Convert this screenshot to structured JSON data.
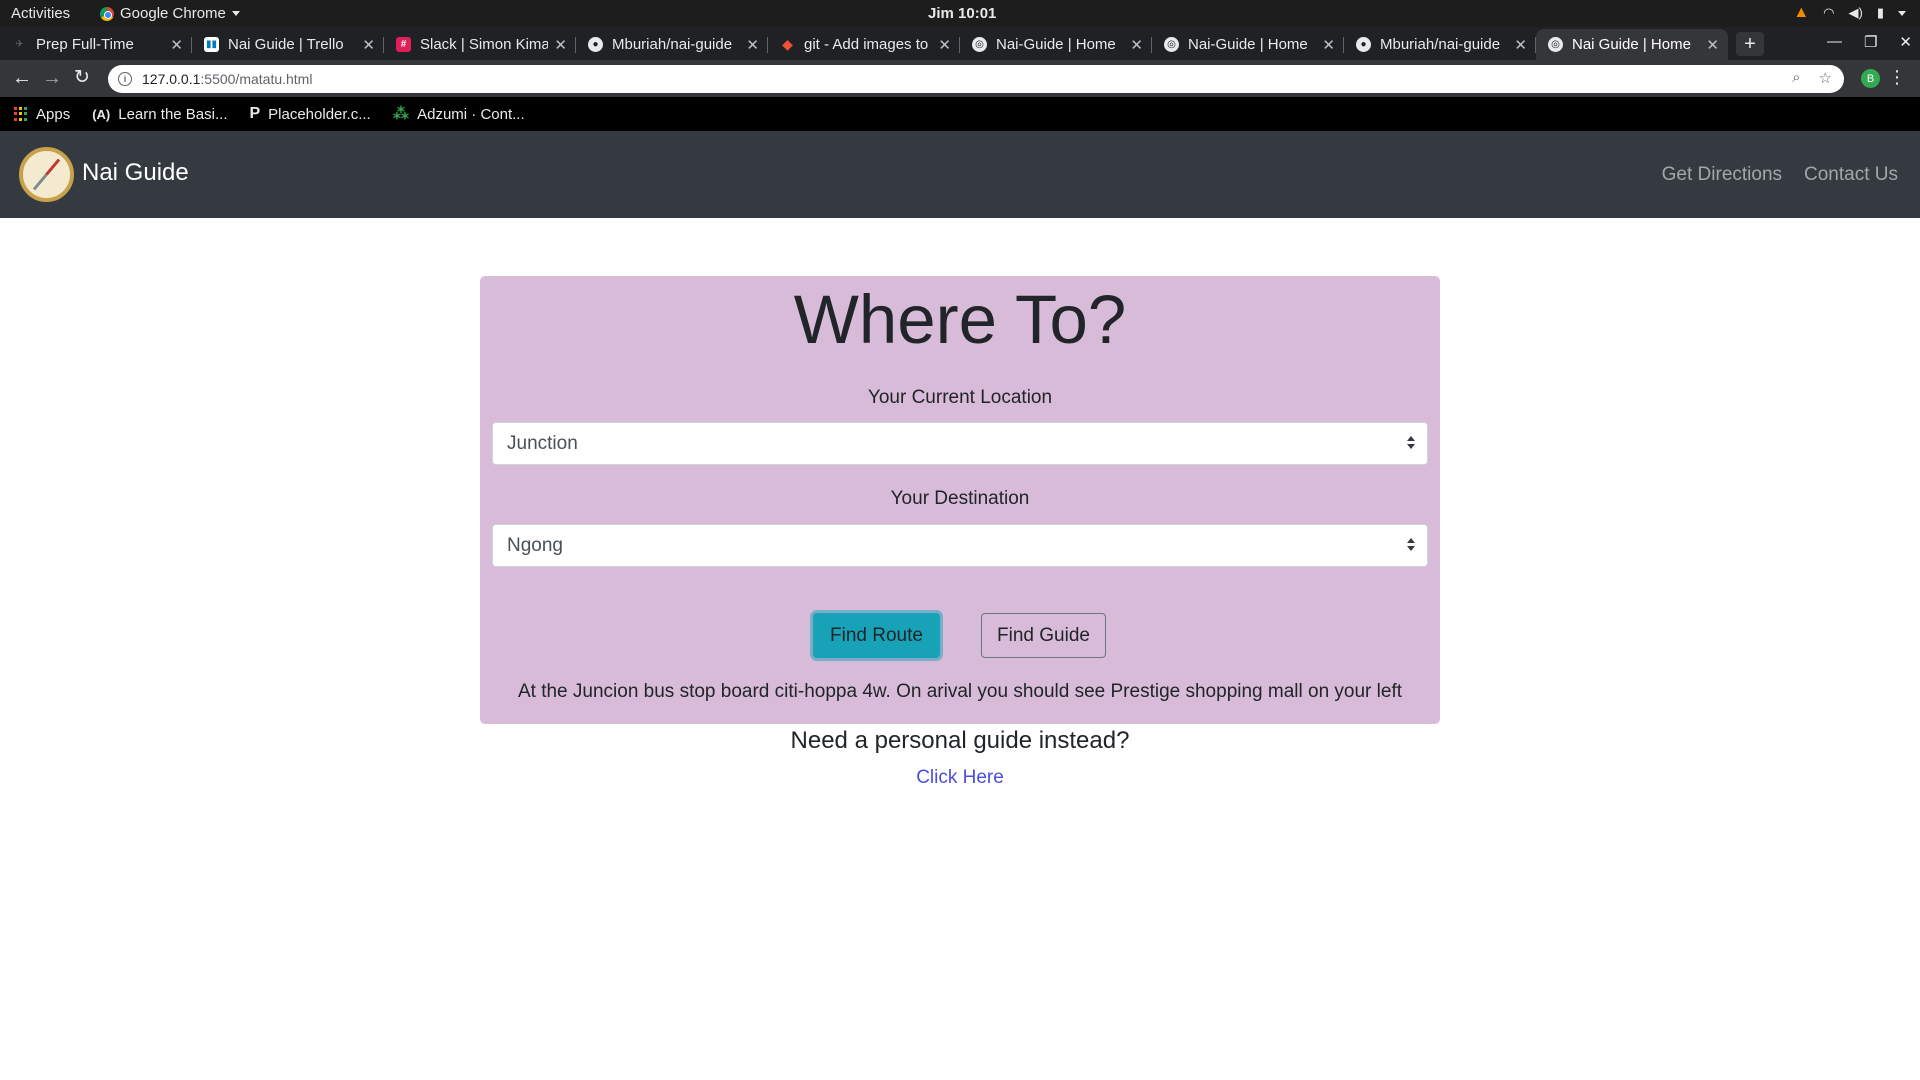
{
  "system_bar": {
    "activities": "Activities",
    "app_name": "Google Chrome",
    "clock": "Jim 10:01"
  },
  "tabs": [
    {
      "title": "Prep Full-Time",
      "icon": "prep-icon",
      "active": false
    },
    {
      "title": "Nai Guide | Trello",
      "icon": "trello-icon",
      "active": false
    },
    {
      "title": "Slack | Simon Kimani",
      "icon": "slack-icon",
      "active": false
    },
    {
      "title": "Mburiah/nai-guide",
      "icon": "github-icon",
      "active": false
    },
    {
      "title": "git - Add images to",
      "icon": "git-icon",
      "active": false
    },
    {
      "title": "Nai-Guide | Home",
      "icon": "globe-icon",
      "active": false
    },
    {
      "title": "Nai-Guide | Home",
      "icon": "globe-icon",
      "active": false
    },
    {
      "title": "Mburiah/nai-guide",
      "icon": "github-icon",
      "active": false
    },
    {
      "title": "Nai Guide | Home",
      "icon": "globe-icon",
      "active": true
    }
  ],
  "address_bar": {
    "host": "127.0.0.1",
    "path": ":5500/matatu.html"
  },
  "profile_initial": "B",
  "bookmarks": [
    {
      "label": "Apps",
      "icon": "apps-grid-icon"
    },
    {
      "label": "Learn the Basi...",
      "icon": "learn-icon"
    },
    {
      "label": "Placeholder.c...",
      "icon": "placeholder-icon"
    },
    {
      "label": "Adzumi · Cont...",
      "icon": "adzumi-icon"
    }
  ],
  "site_nav": {
    "brand": "Nai Guide",
    "links": [
      "Get Directions",
      "Contact Us"
    ]
  },
  "form": {
    "heading": "Where To?",
    "current_label": "Your Current Location",
    "current_value": "Junction",
    "destination_label": "Your Destination",
    "destination_value": "Ngong",
    "find_route": "Find Route",
    "find_guide": "Find Guide",
    "result": "At the Juncion bus stop board citi-hoppa 4w. On arival you should see Prestige shopping mall on your left"
  },
  "personal_guide": {
    "question": "Need a personal guide instead?",
    "link": "Click Here"
  },
  "colors": {
    "card_bg": "#d8bbd8",
    "navbar_bg": "#343a40",
    "route_button": "#17a2b8",
    "link": "#4a4de0"
  }
}
